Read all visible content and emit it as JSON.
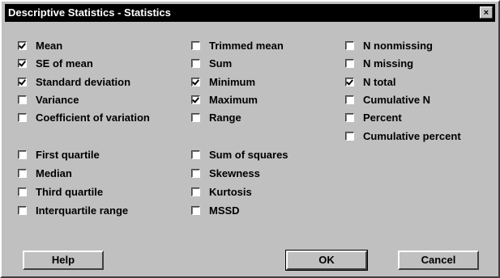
{
  "dialog": {
    "title": "Descriptive Statistics - Statistics",
    "close_glyph": "×"
  },
  "options": {
    "col1": [
      {
        "label": "Mean",
        "checked": true
      },
      {
        "label": "SE of mean",
        "checked": true
      },
      {
        "label": "Standard deviation",
        "checked": true
      },
      {
        "label": "Variance",
        "checked": false
      },
      {
        "label": "Coefficient of variation",
        "checked": false
      },
      {
        "label": "First quartile",
        "checked": false
      },
      {
        "label": "Median",
        "checked": false
      },
      {
        "label": "Third quartile",
        "checked": false
      },
      {
        "label": "Interquartile range",
        "checked": false
      }
    ],
    "col2": [
      {
        "label": "Trimmed mean",
        "checked": false
      },
      {
        "label": "Sum",
        "checked": false
      },
      {
        "label": "Minimum",
        "checked": true
      },
      {
        "label": "Maximum",
        "checked": true
      },
      {
        "label": "Range",
        "checked": false
      },
      {
        "label": "Sum of squares",
        "checked": false
      },
      {
        "label": "Skewness",
        "checked": false
      },
      {
        "label": "Kurtosis",
        "checked": false
      },
      {
        "label": "MSSD",
        "checked": false
      }
    ],
    "col3": [
      {
        "label": "N nonmissing",
        "checked": false
      },
      {
        "label": "N missing",
        "checked": false
      },
      {
        "label": "N total",
        "checked": true
      },
      {
        "label": "Cumulative N",
        "checked": false
      },
      {
        "label": "Percent",
        "checked": false
      },
      {
        "label": "Cumulative percent",
        "checked": false
      }
    ]
  },
  "buttons": {
    "help": "Help",
    "ok": "OK",
    "cancel": "Cancel"
  }
}
